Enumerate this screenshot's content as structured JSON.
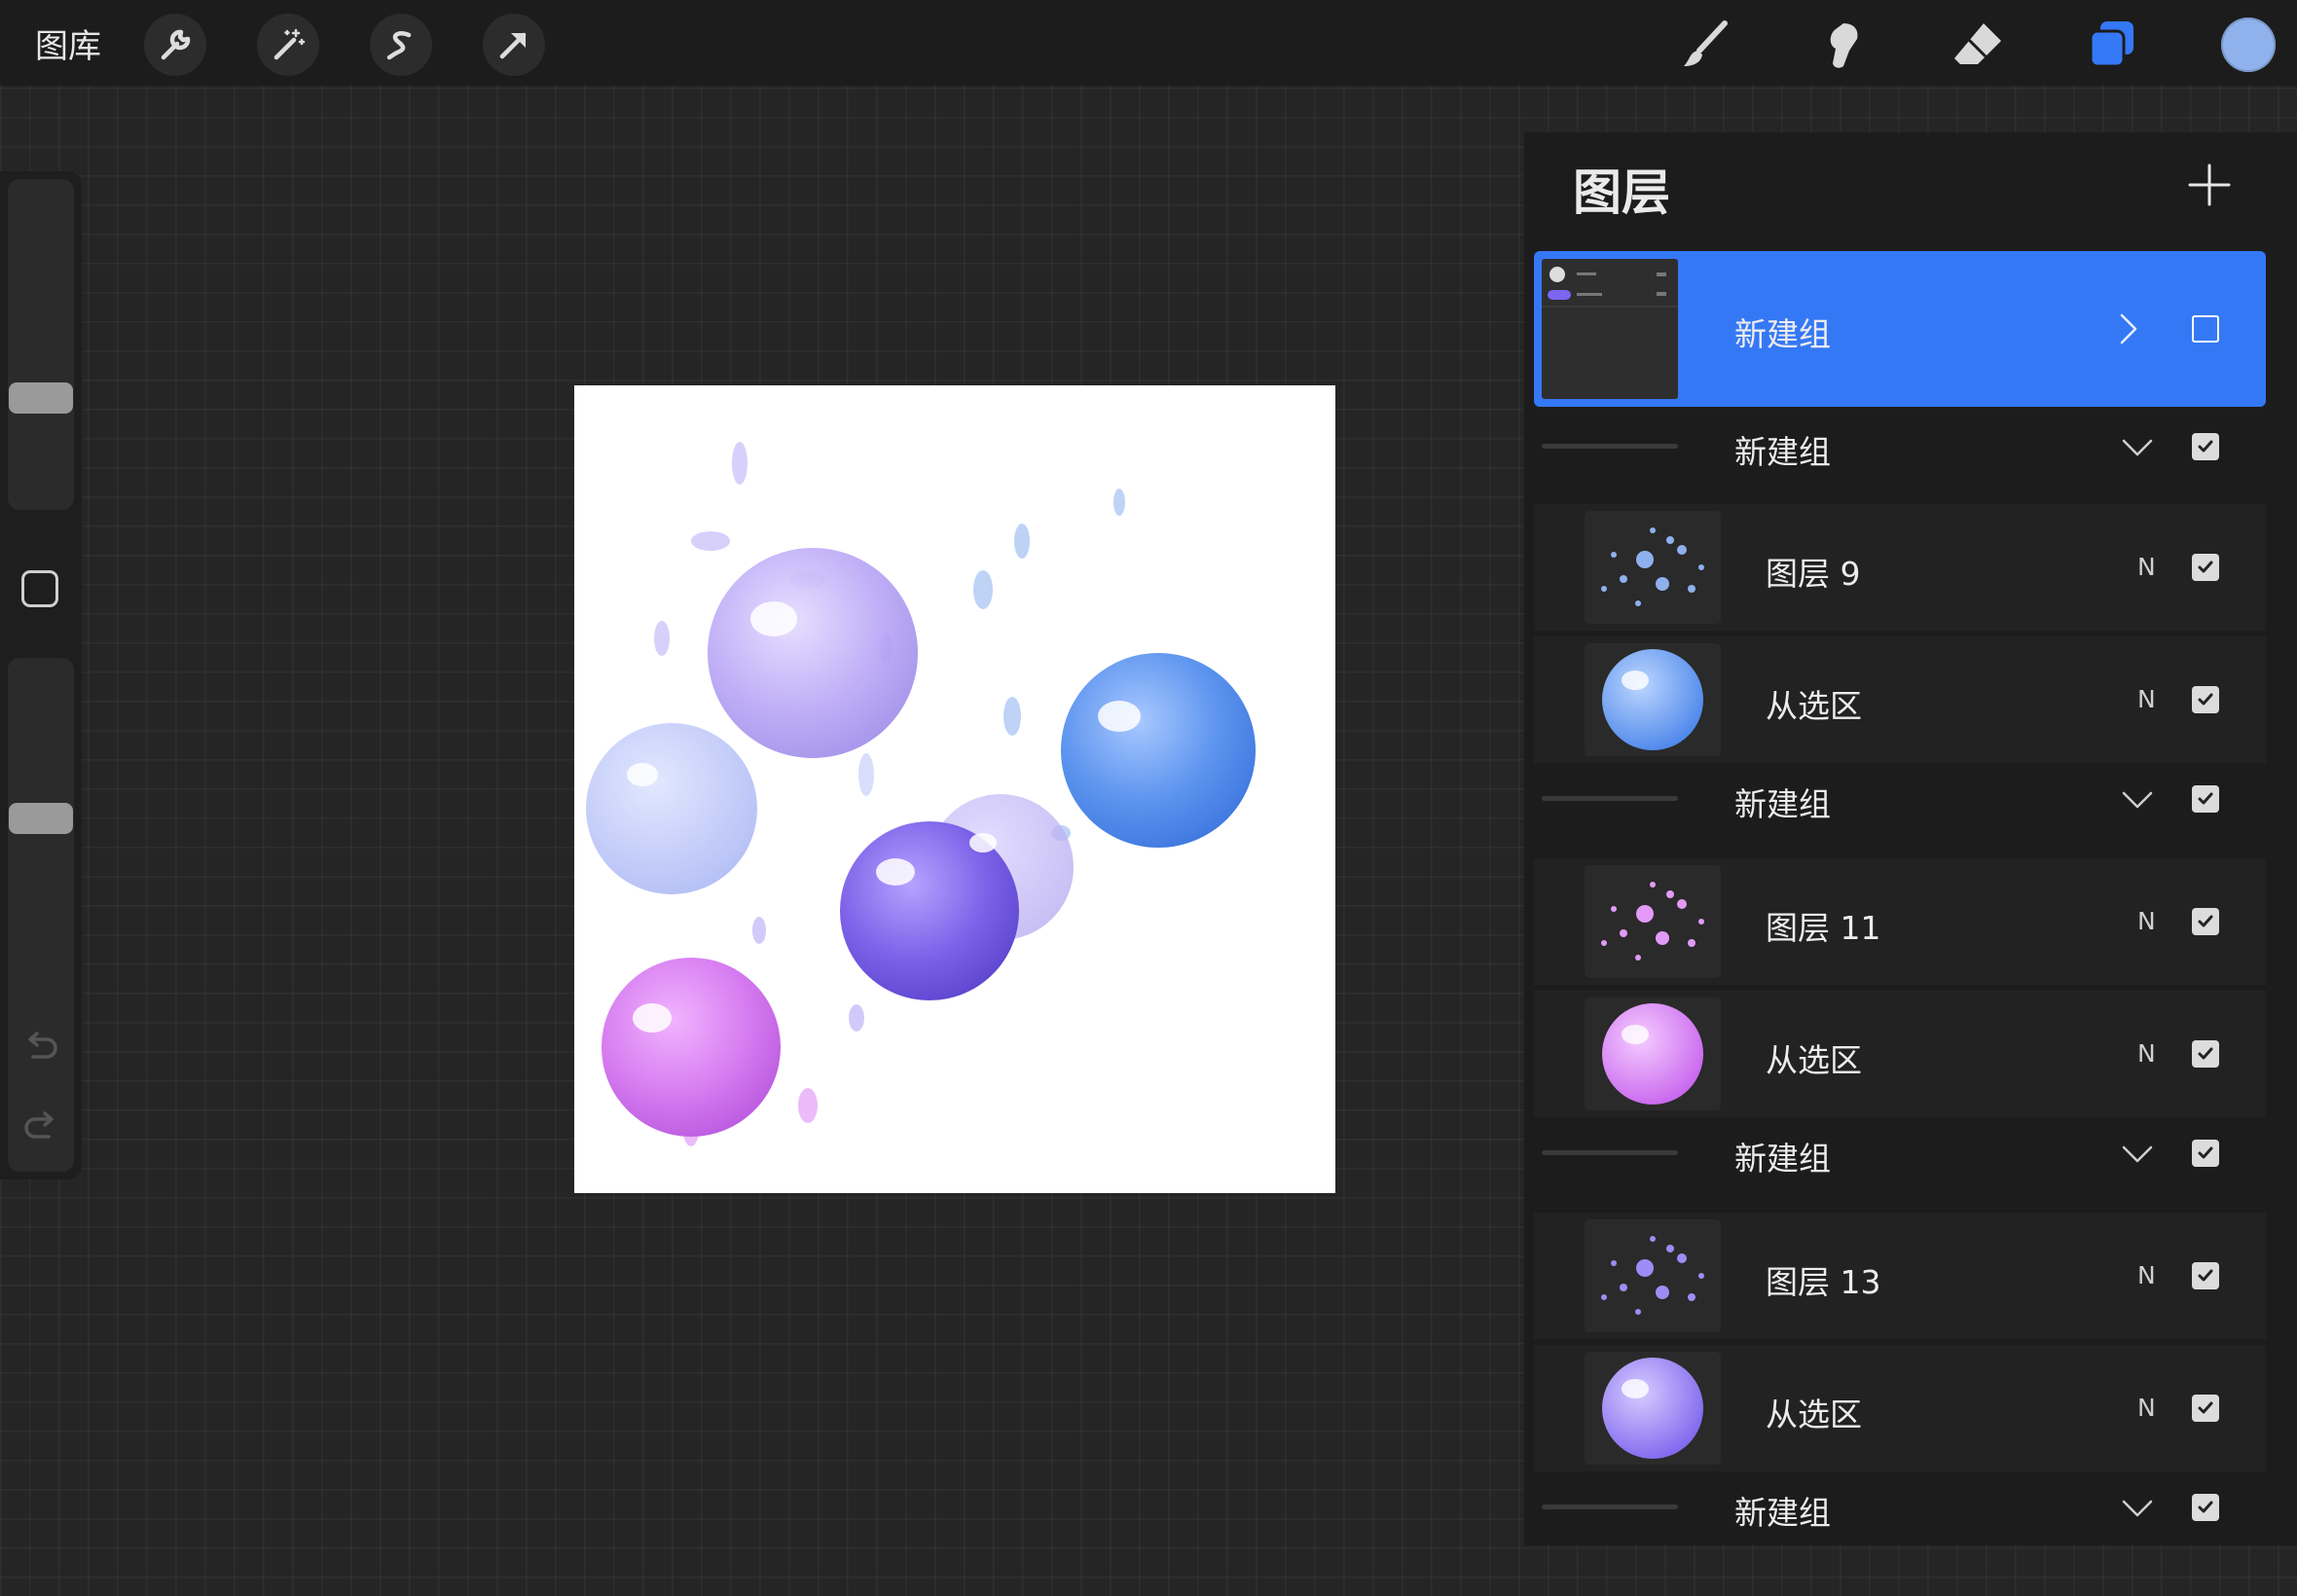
{
  "topbar": {
    "gallery_label": "图库",
    "left_tools": [
      "wrench-icon",
      "magic-wand-icon",
      "selection-icon",
      "transform-arrow-icon"
    ],
    "right_tools": [
      "brush-icon",
      "smudge-icon",
      "eraser-icon",
      "layers-icon",
      "color-swatch"
    ],
    "current_color": "#8fb2ec",
    "accent": "#3578f6"
  },
  "sidebar": {
    "brush_size_level": 0.32,
    "opacity_level": 0.7,
    "icons": [
      "square-modify-icon",
      "undo-icon",
      "redo-icon"
    ]
  },
  "layers_panel": {
    "title": "图层",
    "add_icon": "plus-icon",
    "rows": [
      {
        "kind": "group",
        "name": "新建组",
        "selected": true,
        "expanded": false,
        "visible": false
      },
      {
        "kind": "group",
        "name": "新建组",
        "expanded": true,
        "visible": true
      },
      {
        "kind": "layer",
        "name": "图层 9",
        "mode": "N",
        "visible": true,
        "thumb": "splash-blue"
      },
      {
        "kind": "layer",
        "name": "从选区",
        "mode": "N",
        "visible": true,
        "thumb": "bubble-blue"
      },
      {
        "kind": "group",
        "name": "新建组",
        "expanded": true,
        "visible": true
      },
      {
        "kind": "layer",
        "name": "图层 11",
        "mode": "N",
        "visible": true,
        "thumb": "splash-pink"
      },
      {
        "kind": "layer",
        "name": "从选区",
        "mode": "N",
        "visible": true,
        "thumb": "bubble-pink"
      },
      {
        "kind": "group",
        "name": "新建组",
        "expanded": true,
        "visible": true
      },
      {
        "kind": "layer",
        "name": "图层 13",
        "mode": "N",
        "visible": true,
        "thumb": "splash-purple"
      },
      {
        "kind": "layer",
        "name": "从选区",
        "mode": "N",
        "visible": true,
        "thumb": "bubble-purple"
      },
      {
        "kind": "group",
        "name": "新建组",
        "expanded": true,
        "visible": true
      }
    ]
  }
}
